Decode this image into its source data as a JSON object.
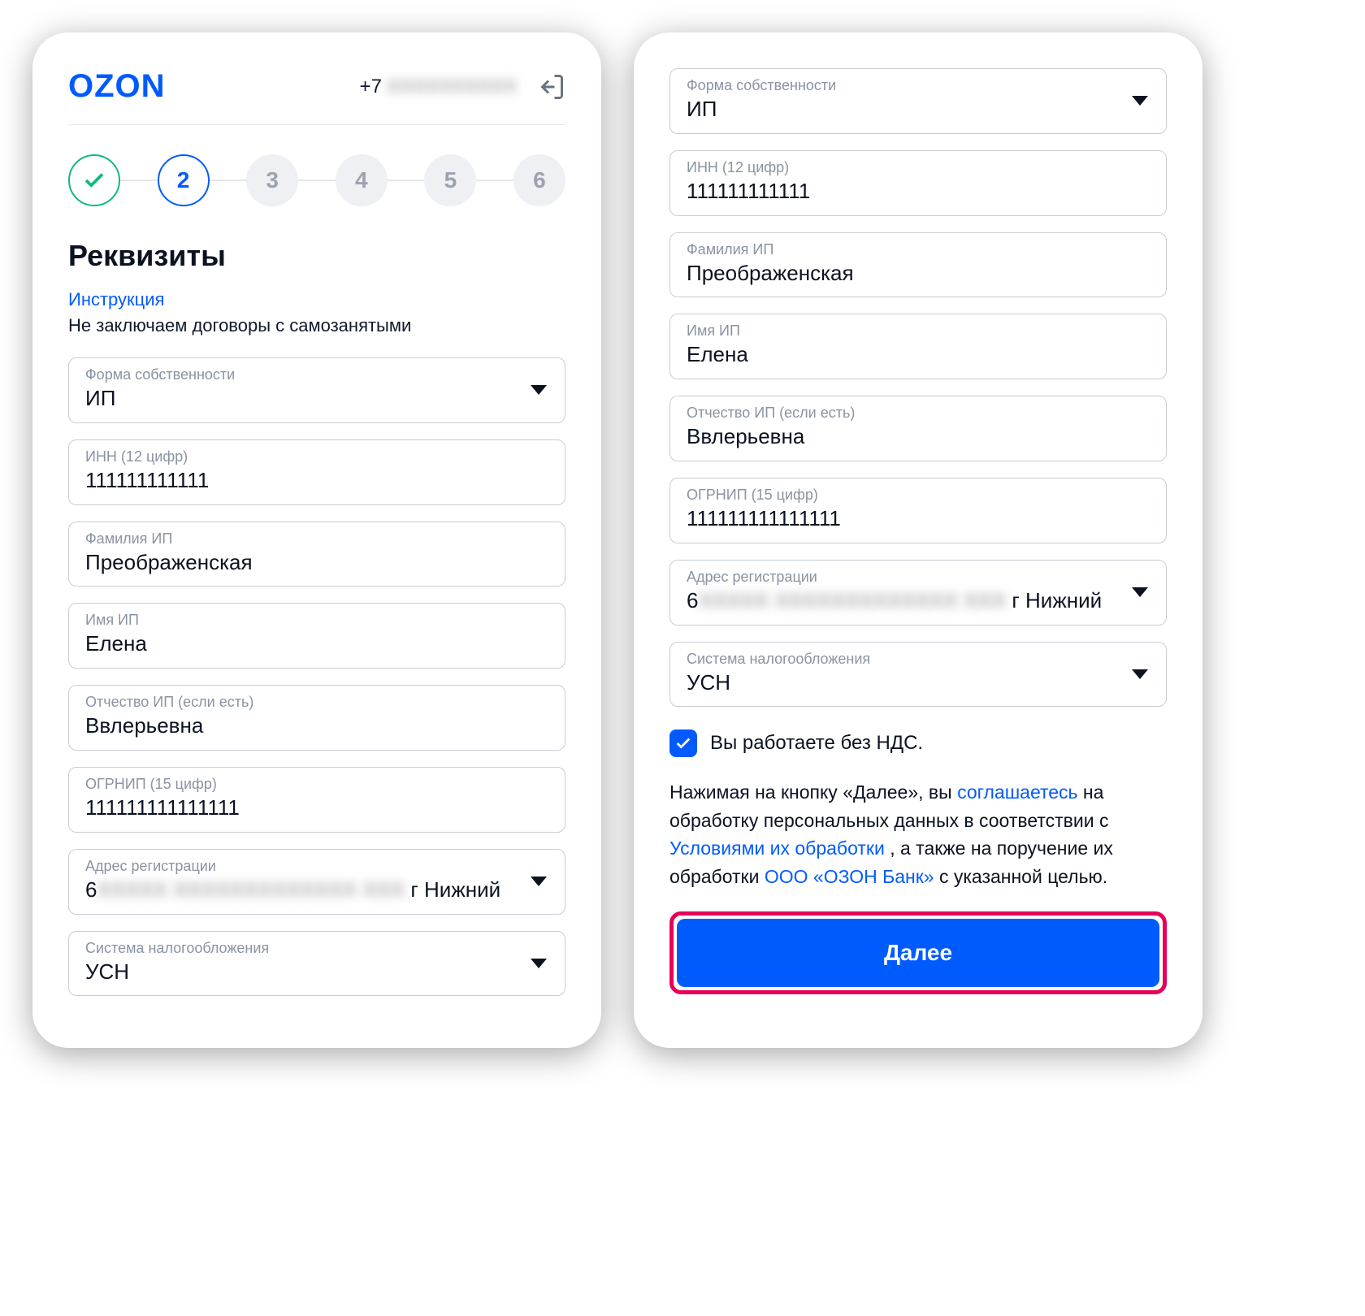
{
  "brand": {
    "logo_text": "OZON"
  },
  "header": {
    "phone_prefix": "+7",
    "phone_rest_masked": "XXXXXXXXXX"
  },
  "stepper": {
    "steps": [
      "done",
      "2",
      "3",
      "4",
      "5",
      "6"
    ],
    "active_index": 1
  },
  "page": {
    "title": "Реквизиты",
    "instruction_link": "Инструкция",
    "no_self_employed_note": "Не заключаем договоры с самозанятыми"
  },
  "fields": {
    "ownership": {
      "label": "Форма собственности",
      "value": "ИП"
    },
    "inn": {
      "label": "ИНН (12 цифр)",
      "value": "111111111111"
    },
    "surname": {
      "label": "Фамилия ИП",
      "value": "Преображенская"
    },
    "name": {
      "label": "Имя ИП",
      "value": "Елена"
    },
    "patronymic": {
      "label": "Отчество ИП (если есть)",
      "value": "Ввлерьевна"
    },
    "ogrnip": {
      "label": "ОГРНИП (15 цифр)",
      "value": "111111111111111"
    },
    "address": {
      "label": "Адрес регистрации",
      "value_prefix": "6",
      "value_masked": "XXXXX XXXXXXXXXXXXX XXX",
      "value_suffix": "г Нижний"
    },
    "tax_system": {
      "label": "Система налогообложения",
      "value": "УСН"
    }
  },
  "vat": {
    "checkbox_label": "Вы работаете без НДС.",
    "checked": true
  },
  "consent": {
    "t1": "Нажимая на кнопку «Далее», вы ",
    "link1": "соглашаетесь",
    "t2": " на обработку персональных данных в соответствии с ",
    "link2": "Условиями их обработки",
    "t3": " , а также на поручение их обработки ",
    "link3": "ООО «ОЗОН Банк»",
    "t4": " с указанной целью."
  },
  "next_button_label": "Далее"
}
